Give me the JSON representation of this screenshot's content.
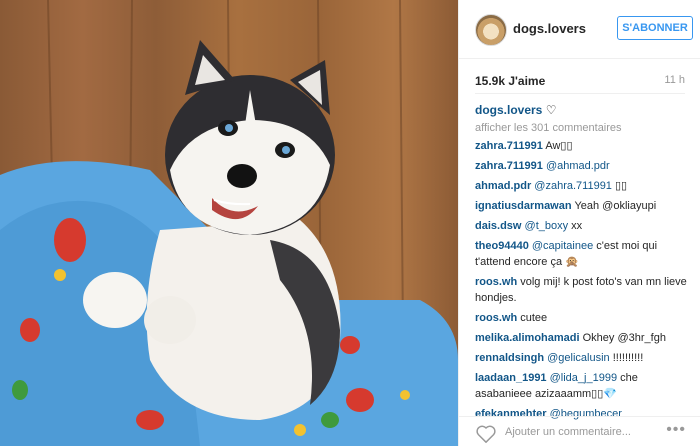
{
  "header": {
    "username": "dogs.lovers",
    "follow_label": "S'ABONNER"
  },
  "stats": {
    "likes": "15.9k J'aime",
    "time": "11 h"
  },
  "caption": {
    "author": "dogs.lovers",
    "text": " ♡"
  },
  "view_all": "afficher les 301 commentaires",
  "comments": [
    {
      "author": "zahra.711991",
      "mention": "",
      "text": "Aw▯▯"
    },
    {
      "author": "zahra.711991",
      "mention": "@ahmad.pdr",
      "text": ""
    },
    {
      "author": "ahmad.pdr",
      "mention": "@zahra.711991",
      "text": "▯▯"
    },
    {
      "author": "ignatiusdarmawan",
      "mention": "",
      "text": "Yeah @okliayupi"
    },
    {
      "author": "dais.dsw",
      "mention": "@t_boxy",
      "text": "xx"
    },
    {
      "author": "theo94440",
      "mention": "@capitainee",
      "text": "c'est moi qui t'attend encore ça 🙊"
    },
    {
      "author": "roos.wh",
      "mention": "",
      "text": "volg mij! k post foto's van mn lieve hondjes."
    },
    {
      "author": "roos.wh",
      "mention": "",
      "text": "cutee"
    },
    {
      "author": "melika.alimohamadi",
      "mention": "",
      "text": "Okhey @3hr_fgh"
    },
    {
      "author": "rennaldsingh",
      "mention": "@gelicalusin",
      "text": "!!!!!!!!!!"
    },
    {
      "author": "laadaan_1991",
      "mention": "@lida_j_1999",
      "text": "che asabanieee azizaaamm▯▯💎"
    },
    {
      "author": "efekanmehter",
      "mention": "@begumbecer",
      "text": ""
    }
  ],
  "bottom": {
    "add_comment_placeholder": "Ajouter un commentaire...",
    "more": "•••"
  }
}
